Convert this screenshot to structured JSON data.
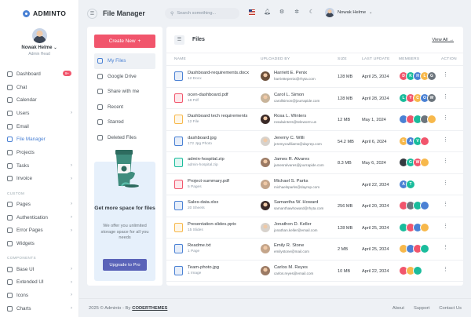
{
  "brand": {
    "name": "ADMINTO"
  },
  "profile": {
    "name": "Nowak Helme",
    "role": "Admin Head"
  },
  "nav": [
    {
      "label": "Dashboard",
      "badge": "9+",
      "name": "dashboard"
    },
    {
      "label": "Chat",
      "name": "chat"
    },
    {
      "label": "Calendar",
      "name": "calendar"
    },
    {
      "label": "Users",
      "chevron": true,
      "name": "users"
    },
    {
      "label": "Email",
      "name": "email"
    },
    {
      "label": "File Manager",
      "active": true,
      "name": "file-manager"
    },
    {
      "label": "Projects",
      "name": "projects"
    },
    {
      "label": "Tasks",
      "chevron": true,
      "name": "tasks"
    },
    {
      "label": "Invoice",
      "chevron": true,
      "name": "invoice"
    },
    {
      "section": "CUSTOM"
    },
    {
      "label": "Pages",
      "chevron": true,
      "name": "pages"
    },
    {
      "label": "Authentication",
      "chevron": true,
      "name": "authentication"
    },
    {
      "label": "Error Pages",
      "chevron": true,
      "name": "error-pages"
    },
    {
      "label": "Widgets",
      "name": "widgets"
    },
    {
      "section": "COMPONENTS"
    },
    {
      "label": "Base UI",
      "chevron": true,
      "name": "base-ui"
    },
    {
      "label": "Extended UI",
      "chevron": true,
      "name": "extended-ui"
    },
    {
      "label": "Icons",
      "chevron": true,
      "name": "icons"
    },
    {
      "label": "Charts",
      "chevron": true,
      "name": "charts"
    }
  ],
  "topbar": {
    "title": "File Manager",
    "search_placeholder": "Search something...",
    "user": "Nowak Helme"
  },
  "left_panel": {
    "create_label": "Create New",
    "items": [
      {
        "label": "My Files",
        "active": true,
        "name": "my-files"
      },
      {
        "label": "Google Drive",
        "name": "google-drive"
      },
      {
        "label": "Share with me",
        "name": "share-with-me"
      },
      {
        "label": "Recent",
        "name": "recent"
      },
      {
        "label": "Starred",
        "name": "starred"
      },
      {
        "label": "Deleted Files",
        "name": "deleted-files"
      }
    ],
    "promo": {
      "title": "Get more space for files",
      "text": "We offer you unlimited storage space for all you needs",
      "button": "Upgrade to Pro"
    }
  },
  "files": {
    "title": "Files",
    "view_all": "View All",
    "columns": [
      "NAME",
      "UPLOADED BY",
      "SIZE",
      "LAST UPDATE",
      "MEMBERS",
      "ACTION"
    ],
    "rows": [
      {
        "name": "Dashboard-requirements.docx",
        "sub": "12 Docx",
        "icon_color": "#4a81d4",
        "user": "Harriett E. Penix",
        "email": "harriettepenix@rhyta.com",
        "avatar": "#6b4f3a",
        "size": "128 MB",
        "date": "April 25, 2024",
        "members": [
          [
            "D",
            "#f1556c"
          ],
          [
            "K",
            "#1abc9c"
          ],
          [
            "H",
            "#4a81d4"
          ],
          [
            "L",
            "#f7b84b"
          ],
          [
            "G",
            "#6c757d"
          ]
        ]
      },
      {
        "name": "ocen-dashboard.pdf",
        "sub": "18 Pdf",
        "icon_color": "#f1556c",
        "user": "Carol L. Simon",
        "email": "carollsimon@jourrapide.com",
        "avatar": "#c8b49a",
        "size": "128 MB",
        "date": "April 28, 2024",
        "members": [
          [
            "L",
            "#1abc9c"
          ],
          [
            "Y",
            "#f1556c"
          ],
          [
            "C",
            "#f7b84b"
          ],
          [
            "O",
            "#4a81d4"
          ],
          [
            "W",
            "#6c757d"
          ]
        ]
      },
      {
        "name": "Dashboard tech requirements",
        "sub": "12 File",
        "icon_color": "#f7b84b",
        "user": "Rosa L. Winters",
        "email": "rosalwinters@teleworm.us",
        "avatar": "#3b2a28",
        "size": "12 MB",
        "date": "May 1, 2024",
        "members": [
          [
            "",
            "#4a81d4"
          ],
          [
            "",
            "#f1556c"
          ],
          [
            "",
            "#1abc9c"
          ],
          [
            "",
            "#6c757d"
          ],
          [
            "",
            "#f7b84b"
          ]
        ]
      },
      {
        "name": "dashboard.jpg",
        "sub": "172 Jpg Photo",
        "icon_color": "#4a81d4",
        "user": "Jeremy C. Willi",
        "email": "jeremycwilliams@dayrep.com",
        "avatar": "#d7d2cc",
        "size": "54.2 MB",
        "date": "April 6, 2024",
        "members": [
          [
            "L",
            "#f7b84b"
          ],
          [
            "A",
            "#4a81d4"
          ],
          [
            "V",
            "#1abc9c"
          ],
          [
            "",
            "#f1556c"
          ]
        ]
      },
      {
        "name": "admin-hospital.zip",
        "sub": "admin-hospital.zip",
        "icon_color": "#1abc9c",
        "user": "James R. Alvares",
        "email": "jamesralvares@jourrapide.com",
        "avatar": "#9b7a64",
        "size": "8.3 MB",
        "date": "May 6, 2024",
        "members": [
          [
            "",
            "#343a40"
          ],
          [
            "G",
            "#1abc9c"
          ],
          [
            "W",
            "#f1556c"
          ],
          [
            "",
            "#f7b84b"
          ]
        ]
      },
      {
        "name": "Project-summary.pdf",
        "sub": "5 Pages",
        "icon_color": "#f1556c",
        "user": "Michael S. Parks",
        "email": "michaelsparks@dayrep.com",
        "avatar": "#c4a58a",
        "size": "",
        "date": "April 22, 2024",
        "members": [
          [
            "A",
            "#4a81d4"
          ],
          [
            "T",
            "#1abc9c"
          ]
        ]
      },
      {
        "name": "Sales-data.xlsx",
        "sub": "20 Sheets",
        "icon_color": "#4a81d4",
        "user": "Samantha W. Howard",
        "email": "samanthawhoward@rhyta.com",
        "avatar": "#3b2a28",
        "size": "256 MB",
        "date": "April 20, 2024",
        "members": [
          [
            "",
            "#f1556c"
          ],
          [
            "",
            "#6c757d"
          ],
          [
            "",
            "#1abc9c"
          ],
          [
            "",
            "#4a81d4"
          ]
        ]
      },
      {
        "name": "Presentation-slides.pptx",
        "sub": "15 Slides",
        "icon_color": "#f7b84b",
        "user": "Jonathon D. Keller",
        "email": "jonathan.keller@email.com",
        "avatar": "#d7d2cc",
        "size": "128 MB",
        "date": "April 25, 2024",
        "members": [
          [
            "",
            "#1abc9c"
          ],
          [
            "",
            "#f1556c"
          ],
          [
            "",
            "#4a81d4"
          ],
          [
            "",
            "#f7b84b"
          ]
        ]
      },
      {
        "name": "Readme.txt",
        "sub": "1 Page",
        "icon_color": "#4a81d4",
        "user": "Emily R. Stone",
        "email": "emilystone@mail.com",
        "avatar": "#c4a58a",
        "size": "2 MB",
        "date": "April 25, 2024",
        "members": [
          [
            "",
            "#f7b84b"
          ],
          [
            "",
            "#4a81d4"
          ],
          [
            "",
            "#f1556c"
          ],
          [
            "",
            "#1abc9c"
          ]
        ]
      },
      {
        "name": "Team-photo.jpg",
        "sub": "1 Image",
        "icon_color": "#4a81d4",
        "user": "Carlos M. Reyes",
        "email": "carlos.reyes@email.com",
        "avatar": "#9b7a64",
        "size": "10 MB",
        "date": "April 22, 2024",
        "members": [
          [
            "",
            "#f1556c"
          ],
          [
            "",
            "#f7b84b"
          ],
          [
            "",
            "#1abc9c"
          ]
        ]
      }
    ]
  },
  "footer": {
    "copyright": "2025 © Adminto - By ",
    "company": "CODERTHEMES",
    "links": [
      "About",
      "Support",
      "Contact Us"
    ]
  }
}
